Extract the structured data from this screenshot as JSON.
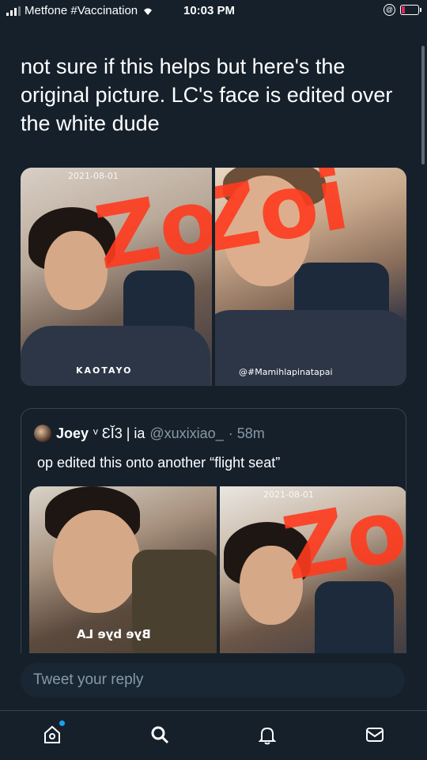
{
  "status_bar": {
    "carrier": "Metfone #Vaccination",
    "time": "10:03 PM"
  },
  "tweet": {
    "text": "not sure if this helps but here's the original picture. LC's face is edited over the white dude",
    "media": [
      {
        "date_stamp": "2021-08-01",
        "overlay_text": "Zoi",
        "caption_text": "KAOTAYO"
      },
      {
        "overlay_text": "Zoi",
        "watermark": "@#Mamihlapinatapai"
      }
    ]
  },
  "quoted_tweet": {
    "name": "Joey",
    "name_suffix": "ᵛ ƐĬ3 | ia",
    "handle": "@xuxixiao_",
    "time": "· 58m",
    "text": "op edited this onto another “flight seat”",
    "media": [
      {
        "caption_text": "Bye bye LA"
      },
      {
        "date_stamp": "2021-08-01",
        "overlay_text": "Zoi"
      }
    ]
  },
  "reply": {
    "placeholder": "Tweet your reply"
  },
  "tabbar": {
    "items": [
      "home",
      "search",
      "notifications",
      "messages"
    ]
  },
  "colors": {
    "background": "#15202b",
    "accent": "#1da1f2",
    "muted": "#8899a6",
    "scribble": "#ff3b1f"
  }
}
